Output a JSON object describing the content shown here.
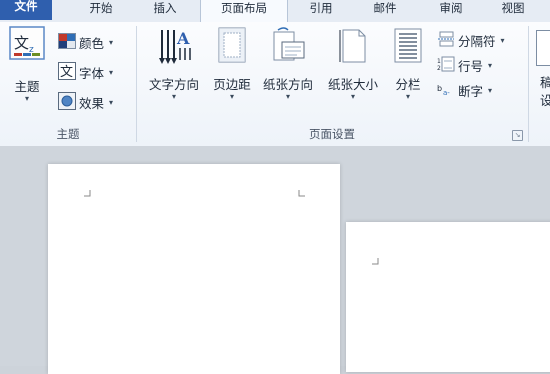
{
  "tabs": [
    {
      "label": "文件"
    },
    {
      "label": "开始"
    },
    {
      "label": "插入"
    },
    {
      "label": "页面布局"
    },
    {
      "label": "引用"
    },
    {
      "label": "邮件"
    },
    {
      "label": "审阅"
    },
    {
      "label": "视图"
    }
  ],
  "themes_group": {
    "label": "主题",
    "theme_button": {
      "label": "主题",
      "icon_text": "文"
    },
    "colors": {
      "label": "颜色"
    },
    "fonts": {
      "label": "字体",
      "icon_text": "文"
    },
    "effects": {
      "label": "效果"
    }
  },
  "page_setup_group": {
    "label": "页面设置",
    "text_direction": {
      "label": "文字方向"
    },
    "margins": {
      "label": "页边距"
    },
    "orientation": {
      "label": "纸张方向"
    },
    "size": {
      "label": "纸张大小"
    },
    "columns": {
      "label": "分栏"
    },
    "breaks": {
      "label": "分隔符"
    },
    "line_numbers": {
      "label": "行号"
    },
    "hyphenation": {
      "label": "断字"
    }
  },
  "next_group_partial": {
    "line1": "稿",
    "line2": "设"
  },
  "colors": {
    "file_tab": "#2f5fae",
    "ribbon_bg": "#f4f7fb",
    "doc_bg": "#cfd5dc",
    "page": "#ffffff"
  }
}
